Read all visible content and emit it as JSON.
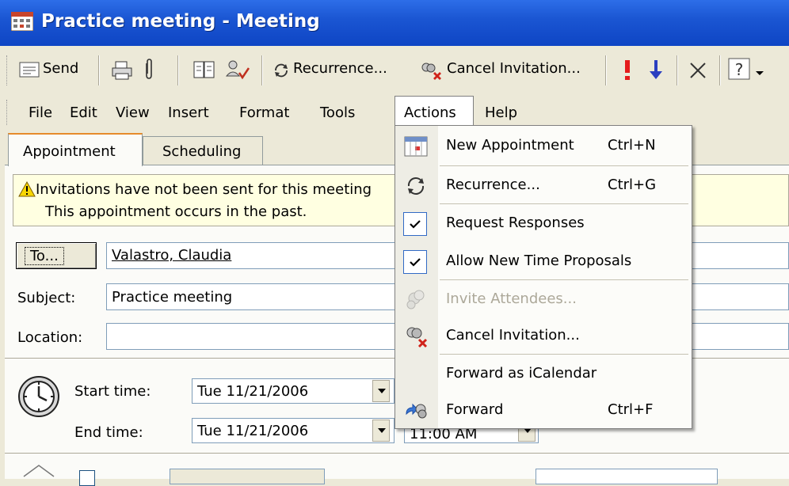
{
  "window": {
    "title": "Practice meeting - Meeting"
  },
  "toolbar": {
    "send_label": "Send",
    "recurrence_label": "Recurrence...",
    "cancel_invitation_label": "Cancel Invitation..."
  },
  "menubar": {
    "items": [
      "File",
      "Edit",
      "View",
      "Insert",
      "Format",
      "Tools",
      "Actions",
      "Help"
    ]
  },
  "tabs": [
    {
      "label": "Appointment"
    },
    {
      "label": "Scheduling"
    }
  ],
  "infobar": {
    "line1": "Invitations have not been sent for this meeting",
    "line2": "This appointment occurs in the past."
  },
  "form": {
    "to_button": "To...",
    "to_value": "Valastro, Claudia",
    "subject_label": "Subject:",
    "subject_value": "Practice meeting",
    "location_label": "Location:",
    "location_value": "",
    "start_label": "Start time:",
    "start_date": "Tue 11/21/2006",
    "end_label": "End time:",
    "end_date": "Tue 11/21/2006",
    "end_time": "11:00 AM"
  },
  "actions_menu": {
    "items": [
      {
        "label": "New Appointment",
        "shortcut": "Ctrl+N",
        "icon": "new-appointment-icon"
      },
      {
        "label": "Recurrence...",
        "shortcut": "Ctrl+G",
        "icon": "recurrence-icon"
      },
      {
        "label": "Request Responses",
        "shortcut": "",
        "checked": true
      },
      {
        "label": "Allow New Time Proposals",
        "shortcut": "",
        "checked": true
      },
      {
        "label": "Invite Attendees...",
        "shortcut": "",
        "disabled": true,
        "icon": "invite-attendees-icon"
      },
      {
        "label": "Cancel Invitation...",
        "shortcut": "",
        "icon": "cancel-invitation-icon"
      },
      {
        "label": "Forward as iCalendar",
        "shortcut": ""
      },
      {
        "label": "Forward",
        "shortcut": "Ctrl+F",
        "icon": "forward-icon"
      }
    ]
  },
  "colors": {
    "titlebar": "#1b56d3",
    "menu_highlight": "#316ac5",
    "infobar": "#ffffe1",
    "toolbar_bg": "#ece9d8"
  }
}
